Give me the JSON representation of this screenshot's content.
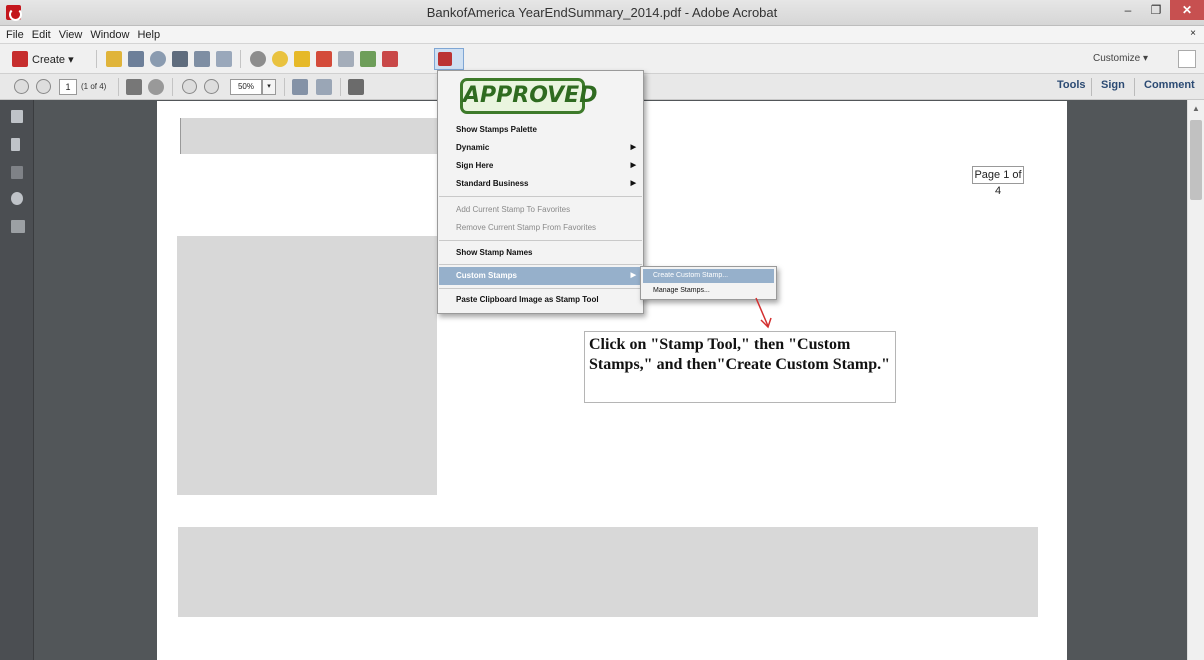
{
  "window": {
    "title": "BankofAmerica YearEndSummary_2014.pdf - Adobe Acrobat",
    "minimize": "–",
    "maximize": "❐",
    "close": "✕"
  },
  "menubar": {
    "items": [
      "File",
      "Edit",
      "View",
      "Window",
      "Help"
    ],
    "close_glyph": "×"
  },
  "toolbar": {
    "create_label": "Create ▾",
    "customize_label": "Customize ▾"
  },
  "navbar": {
    "page_number": "1",
    "page_of": "(1 of 4)",
    "zoom": "50%",
    "zoom_dropdown": "▾",
    "tabs": [
      "Tools",
      "Sign",
      "Comment"
    ]
  },
  "document": {
    "page_label": "Page 1 of 4"
  },
  "stamp_menu": {
    "preview_stamp": "APPROVED",
    "items": [
      {
        "label": "Show Stamps Palette",
        "enabled": true,
        "submenu": false
      },
      {
        "label": "Dynamic",
        "enabled": true,
        "submenu": true
      },
      {
        "label": "Sign Here",
        "enabled": true,
        "submenu": true
      },
      {
        "label": "Standard Business",
        "enabled": true,
        "submenu": true
      },
      {
        "label": "Add Current Stamp To Favorites",
        "enabled": false,
        "submenu": false
      },
      {
        "label": "Remove Current Stamp From Favorites",
        "enabled": false,
        "submenu": false
      },
      {
        "label": "Show Stamp Names",
        "enabled": true,
        "submenu": false
      },
      {
        "label": "Custom Stamps",
        "enabled": true,
        "submenu": true,
        "highlighted": true
      },
      {
        "label": "Paste Clipboard Image as Stamp Tool",
        "enabled": true,
        "submenu": false
      }
    ],
    "submenu_arrow": "▶"
  },
  "custom_stamps_submenu": {
    "items": [
      {
        "label": "Create Custom Stamp...",
        "highlighted": true
      },
      {
        "label": "Manage Stamps...",
        "highlighted": false
      }
    ]
  },
  "annotation": {
    "text": "Click on \"Stamp Tool,\" then \"Custom Stamps,\" and then\"Create Custom Stamp.\""
  },
  "colors": {
    "menu_highlight": "#96b0cb",
    "stamp_green": "#3d7a2a",
    "viewport_bg": "#525659",
    "arrow_red": "#d32f2f"
  }
}
